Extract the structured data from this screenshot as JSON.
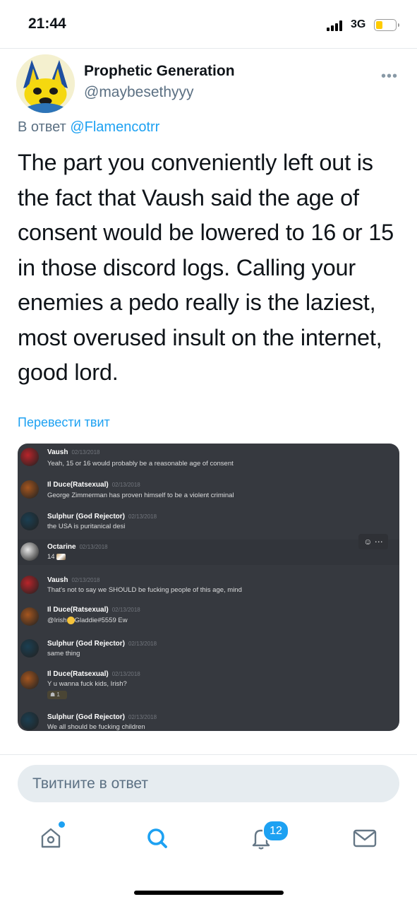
{
  "status_bar": {
    "time": "21:44",
    "network": "3G"
  },
  "tweet": {
    "display_name": "Prophetic Generation",
    "handle": "@maybesethyyy",
    "reply_prefix": "В ответ",
    "reply_to": "@Flamencotrr",
    "text": "The part you conveniently left out is the fact that Vaush said the age of consent would be lowered to 16 or 15 in those discord logs. Calling your enemies a pedo really is the laziest, most overused insult on the internet, good lord.",
    "translate": "Перевести твит"
  },
  "discord": {
    "messages": [
      {
        "author": "Vaush",
        "date": "02/13/2018",
        "text": "Yeah, 15 or 16 would probably be a reasonable age of consent",
        "avatar_color": "#b8242a"
      },
      {
        "author": "Il Duce(Ratsexual)",
        "date": "02/13/2018",
        "text": "George Zimmerman has proven himself to be a violent criminal",
        "avatar_color": "#a5561f"
      },
      {
        "author": "Sulphur (God Rejector)",
        "date": "02/13/2018",
        "text": "the USA is puritanical desi",
        "avatar_color": "#1b3f52"
      },
      {
        "author": "Octarine",
        "date": "02/13/2018",
        "text": "14",
        "avatar_color": "#e6e6e6"
      },
      {
        "author": "Vaush",
        "date": "02/13/2018",
        "text": "That's not to say we SHOULD be fucking people of this age, mind",
        "avatar_color": "#b8242a"
      },
      {
        "author": "Il Duce(Ratsexual)",
        "date": "02/13/2018",
        "text_before": "@Irish",
        "text_after": "Gladdie#5559 Ew",
        "avatar_color": "#a5561f"
      },
      {
        "author": "Sulphur (God Rejector)",
        "date": "02/13/2018",
        "text": "same thing",
        "avatar_color": "#1b3f52"
      },
      {
        "author": "Il Duce(Ratsexual)",
        "date": "02/13/2018",
        "text": "Y u wanna fuck kids, Irish?",
        "reaction_count": "1",
        "avatar_color": "#a5561f"
      },
      {
        "author": "Sulphur (God Rejector)",
        "date": "02/13/2018",
        "text": "We all should be fucking children",
        "avatar_color": "#1b3f52"
      }
    ]
  },
  "reply_box": {
    "placeholder": "Твитните в ответ"
  },
  "tab_bar": {
    "notifications_badge": "12"
  },
  "colors": {
    "accent": "#1da1f2",
    "discord_bg": "#36393f"
  }
}
